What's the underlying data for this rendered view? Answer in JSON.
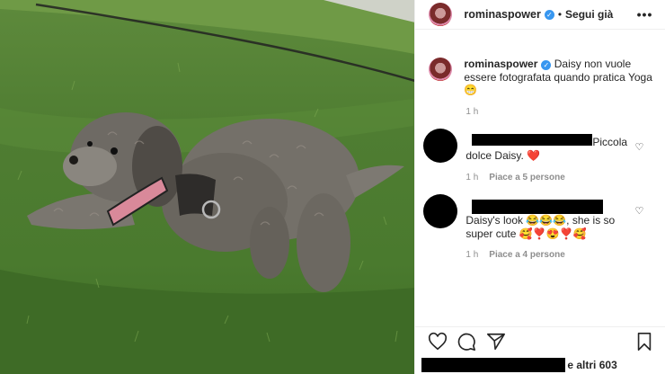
{
  "header": {
    "username": "rominaspower",
    "separator": "•",
    "follow_label": "Segui già",
    "more_label": "•••"
  },
  "caption": {
    "username": "rominaspower",
    "text": "Daisy non vuole essere fotografata quando pratica Yoga 😁",
    "time": "1 h"
  },
  "comments": [
    {
      "text": "Piccola dolce Daisy. ❤️",
      "time": "1 h",
      "likes": "Piace a 5 persone"
    },
    {
      "text": "Daisy's look 😂😂😂, she is so super cute 🥰❣️😍❣️🥰",
      "time": "1 h",
      "likes": "Piace a 4 persone"
    }
  ],
  "likes_summary": "e altri 603",
  "icons": [
    "heart-icon",
    "comment-icon",
    "share-icon",
    "bookmark-icon",
    "verified-badge-icon",
    "more-options-icon"
  ],
  "colors": {
    "verified": "#3897f0",
    "secondary_text": "#8e8e8e",
    "divider": "#efefef"
  }
}
